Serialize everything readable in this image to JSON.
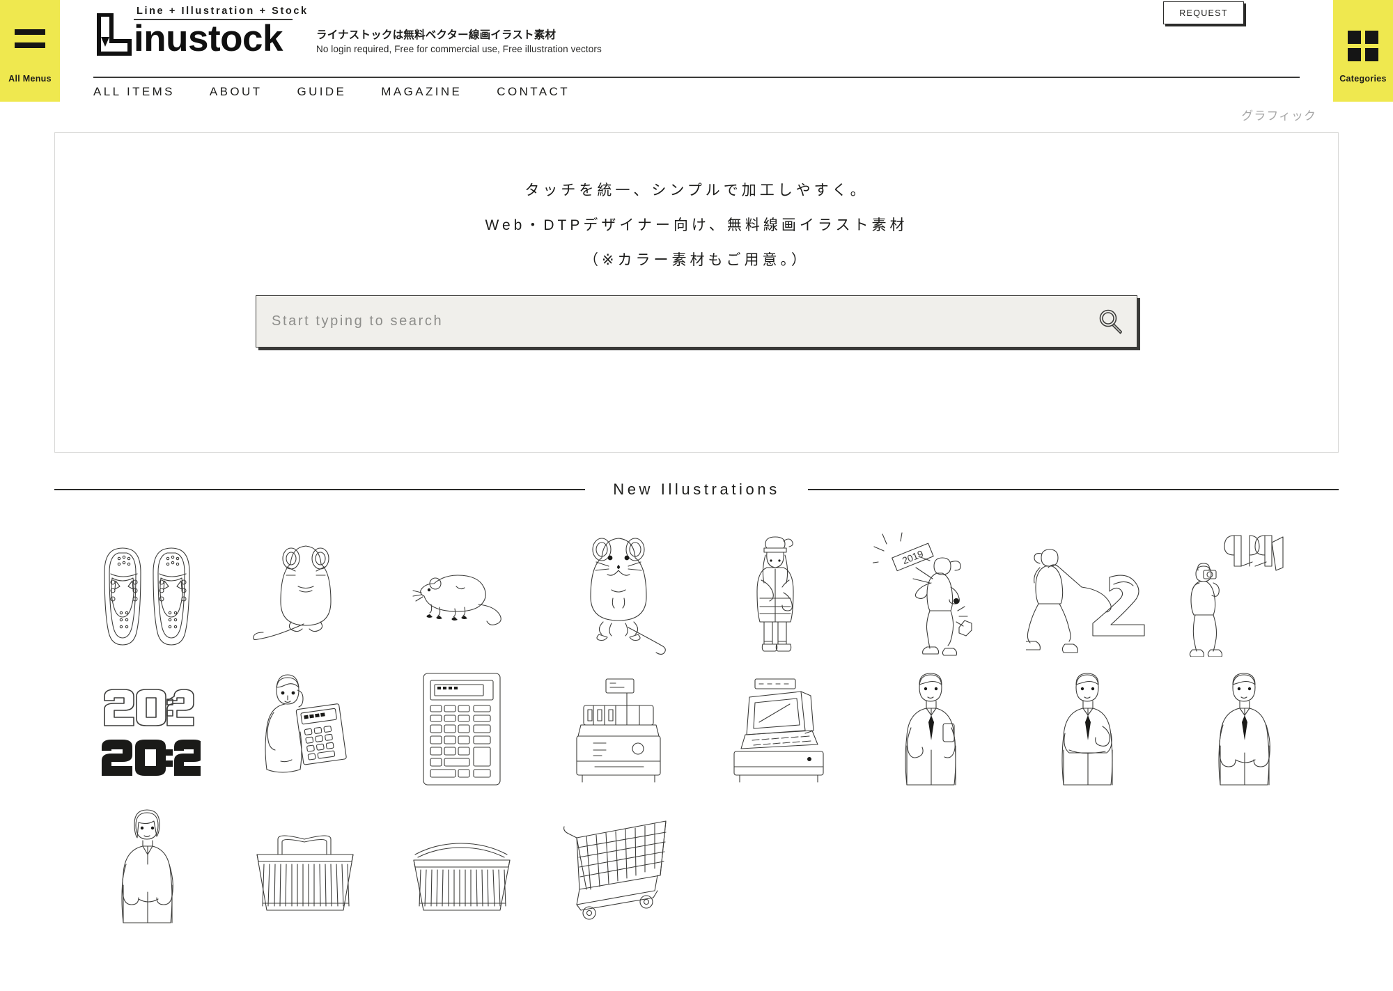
{
  "left_rail": {
    "icon": "hamburger-icon",
    "label": "All Menus"
  },
  "right_rail": {
    "icon": "grid-squares-icon",
    "label": "Categories"
  },
  "header": {
    "logo_supertitle": "Line + Illustration + Stock",
    "logo_word": "inustock",
    "logo_mark": "pen-L-logo-icon",
    "tagline_ja": "ライナストックは無料ベクター線画イラスト素材",
    "tagline_en": "No login required, Free for commercial use, Free illustration vectors",
    "request_label": "REQUEST",
    "nav": [
      {
        "label": "ALL ITEMS"
      },
      {
        "label": "ABOUT"
      },
      {
        "label": "GUIDE"
      },
      {
        "label": "MAGAZINE"
      },
      {
        "label": "CONTACT"
      }
    ]
  },
  "category_tag": "グラフィック",
  "hero": {
    "lines": [
      "タッチを統一、シンプルで加工しやすく。",
      "Web・DTPデザイナー向け、無料線画イラスト素材",
      "（※カラー素材もご用意。）"
    ],
    "search": {
      "placeholder": "Start typing to search",
      "value": "",
      "icon": "search-icon"
    }
  },
  "section": {
    "title": "New Illustrations"
  },
  "illustrations": [
    {
      "name": "sandals-pair"
    },
    {
      "name": "mouse-standing-back"
    },
    {
      "name": "mouse-side-view"
    },
    {
      "name": "mouse-front-view"
    },
    {
      "name": "woman-winter-coat"
    },
    {
      "name": "person-throwing-2019"
    },
    {
      "name": "person-pulling-number-2"
    },
    {
      "name": "person-photographing-2019-sign"
    },
    {
      "name": "number-2020-outline-and-solid"
    },
    {
      "name": "woman-holding-calculator"
    },
    {
      "name": "calculator-device"
    },
    {
      "name": "cash-register-old"
    },
    {
      "name": "cash-register-pos"
    },
    {
      "name": "businessman-holding-phone"
    },
    {
      "name": "businessman-arms-crossed"
    },
    {
      "name": "businessman-standing"
    },
    {
      "name": "businesswoman-standing"
    },
    {
      "name": "shopping-basket-with-handle"
    },
    {
      "name": "shopping-basket-flat"
    },
    {
      "name": "shopping-cart"
    }
  ],
  "colors": {
    "accent_yellow": "#efe84f",
    "ink": "#1d1d1b",
    "line": "#3c3c3a",
    "search_bg": "#f0efeb",
    "muted": "#a8a8a8"
  }
}
